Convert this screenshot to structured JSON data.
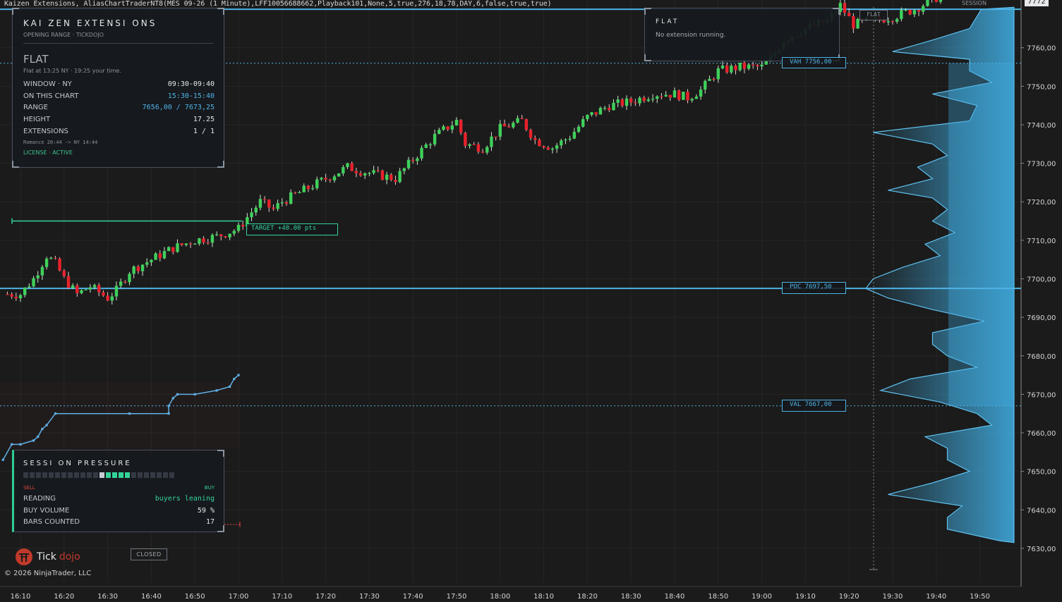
{
  "window": {
    "title": "Kaizen Extensions, AliasChartTraderNT8(MES 09-26 (1 Minute),LFF10056688662,Playback101,None,5,true,276,18,78,DAY,6,false,true,true)"
  },
  "kaizen_panel": {
    "title": "KAI ZEN  EXTENSI ONS",
    "subtitle": "OPENING RANGE · TICKDOJO",
    "state": "FLAT",
    "state_note": "Flat at 13:25 NY · 19:25 your time.",
    "rows": [
      {
        "label": "WINDOW · NY",
        "value": "09:30-09:40",
        "accent": false
      },
      {
        "label": "ON THIS CHART",
        "value": "15:30-15:40",
        "accent": true
      },
      {
        "label": "RANGE",
        "value": "7656,00 / 7673,25",
        "accent": true
      },
      {
        "label": "HEIGHT",
        "value": "17.25",
        "accent": false
      },
      {
        "label": "EXTENSIONS",
        "value": "1 / 1",
        "accent": false
      }
    ],
    "timezone_note": "Romance 20:44  ->  NY 14:44",
    "license": "LICENSE · ACTIVE"
  },
  "flat_panel": {
    "title": "FLAT",
    "message": "No extension running."
  },
  "session_pressure": {
    "title": "SESSI ON  PRESSURE",
    "sell_label": "SELL",
    "buy_label": "BUY",
    "meter_segments": 24,
    "meter_marker_index": 12,
    "meter_buy_filled": [
      13,
      14,
      15,
      16
    ],
    "rows": [
      {
        "label": "READING",
        "value": "buyers leaning",
        "color": "#34d399"
      },
      {
        "label": "BUY VOLUME",
        "value": "59 %",
        "color": "#e6e8eb"
      },
      {
        "label": "BARS COUNTED",
        "value": "17",
        "color": "#e6e8eb"
      }
    ]
  },
  "tags": {
    "target": "TARGET  +40.00 pts",
    "vah": "VAH  7756,00",
    "poc": "POC  7697,50",
    "val": "VAL  7667,00",
    "flat": "FLAT",
    "closed": "CLOSED",
    "session": "SESSION",
    "top_price": "7772"
  },
  "branding": {
    "logo_tick": "Tick",
    "logo_dojo": "dojo",
    "copyright": "© 2026 NinjaTrader, LLC"
  },
  "colors": {
    "up": "#3fd05a",
    "down": "#e8222c",
    "level_line": "#4fb3e6",
    "profile": "#3fa9dc",
    "green_accent": "#34d399",
    "background": "#1b1b1b"
  },
  "chart_data": {
    "type": "candlestick",
    "instrument": "MES 09-26 (1 Minute)",
    "y_tick_labels": [
      "7760,00",
      "7750,00",
      "7740,00",
      "7730,00",
      "7720,00",
      "7710,00",
      "7700,00",
      "7690,00",
      "7680,00",
      "7670,00",
      "7660,00",
      "7650,00",
      "7640,00",
      "7630,00"
    ],
    "y_ticks": [
      7760,
      7750,
      7740,
      7730,
      7720,
      7710,
      7700,
      7690,
      7680,
      7670,
      7660,
      7650,
      7640,
      7630
    ],
    "ylim": [
      7625.5,
      7774.5
    ],
    "x_tick_labels": [
      "16:10",
      "16:20",
      "16:30",
      "16:40",
      "16:50",
      "17:00",
      "17:10",
      "17:20",
      "17:30",
      "17:40",
      "17:50",
      "18:00",
      "18:10",
      "18:20",
      "18:30",
      "18:40",
      "18:50",
      "19:00",
      "19:10",
      "19:20",
      "19:30",
      "19:40",
      "19:50"
    ],
    "levels": {
      "vah": 7756.0,
      "poc": 7697.5,
      "val": 7667.0,
      "upper_line": 7770.0,
      "target": 7715.0
    },
    "grid": true,
    "close_series": [
      [
        "16:07",
        7696
      ],
      [
        "16:10",
        7696
      ],
      [
        "16:13",
        7700
      ],
      [
        "16:16",
        7706
      ],
      [
        "16:18",
        7704
      ],
      [
        "16:20",
        7700
      ],
      [
        "16:23",
        7696
      ],
      [
        "16:26",
        7698
      ],
      [
        "16:30",
        7695
      ],
      [
        "16:32",
        7697
      ],
      [
        "16:35",
        7702
      ],
      [
        "16:40",
        7705
      ],
      [
        "16:45",
        7708
      ],
      [
        "16:50",
        7710
      ],
      [
        "16:55",
        7711
      ],
      [
        "17:00",
        7713
      ],
      [
        "17:02",
        7716
      ],
      [
        "17:05",
        7720
      ],
      [
        "17:08",
        7718
      ],
      [
        "17:10",
        7720
      ],
      [
        "17:15",
        7723
      ],
      [
        "17:20",
        7726
      ],
      [
        "17:25",
        7729
      ],
      [
        "17:28",
        7728
      ],
      [
        "17:32",
        7727
      ],
      [
        "17:36",
        7726
      ],
      [
        "17:40",
        7731
      ],
      [
        "17:45",
        7737
      ],
      [
        "17:50",
        7741
      ],
      [
        "17:52",
        7735
      ],
      [
        "17:56",
        7734
      ],
      [
        "18:00",
        7739
      ],
      [
        "18:05",
        7741
      ],
      [
        "18:08",
        7736
      ],
      [
        "18:12",
        7734
      ],
      [
        "18:16",
        7737
      ],
      [
        "18:20",
        7742
      ],
      [
        "18:25",
        7745
      ],
      [
        "18:30",
        7746
      ],
      [
        "18:35",
        7748
      ],
      [
        "18:40",
        7748
      ],
      [
        "18:43",
        7747
      ],
      [
        "18:46",
        7749
      ],
      [
        "18:50",
        7754
      ],
      [
        "18:55",
        7755
      ],
      [
        "19:00",
        7755
      ],
      [
        "19:02",
        7757
      ],
      [
        "19:05",
        7762
      ],
      [
        "19:10",
        7765
      ],
      [
        "19:15",
        7767
      ],
      [
        "19:18",
        7771
      ],
      [
        "19:21",
        7766
      ],
      [
        "19:25",
        7767
      ],
      [
        "19:30",
        7768
      ],
      [
        "19:35",
        7770
      ],
      [
        "19:40",
        7773
      ],
      [
        "19:45",
        7776
      ],
      [
        "19:50",
        7776
      ]
    ],
    "volume_profile": {
      "right_edge_price_range": [
        7631.5,
        7770.5
      ],
      "points": [
        [
          7770,
          0.22
        ],
        [
          7765,
          0.3
        ],
        [
          7762,
          0.55
        ],
        [
          7759,
          0.82
        ],
        [
          7757,
          0.3
        ],
        [
          7754,
          0.3
        ],
        [
          7751,
          0.15
        ],
        [
          7748,
          0.55
        ],
        [
          7745,
          0.25
        ],
        [
          7741,
          0.3
        ],
        [
          7738,
          0.95
        ],
        [
          7735,
          0.55
        ],
        [
          7732,
          0.45
        ],
        [
          7729,
          0.65
        ],
        [
          7726,
          0.55
        ],
        [
          7723,
          0.85
        ],
        [
          7721,
          0.55
        ],
        [
          7718,
          0.45
        ],
        [
          7715,
          0.55
        ],
        [
          7712,
          0.4
        ],
        [
          7709,
          0.6
        ],
        [
          7706,
          0.5
        ],
        [
          7703,
          0.75
        ],
        [
          7700,
          0.95
        ],
        [
          7697.5,
          1.0
        ],
        [
          7695,
          0.85
        ],
        [
          7692,
          0.55
        ],
        [
          7689,
          0.2
        ],
        [
          7686,
          0.55
        ],
        [
          7683,
          0.55
        ],
        [
          7680,
          0.45
        ],
        [
          7677,
          0.25
        ],
        [
          7674,
          0.7
        ],
        [
          7671,
          0.9
        ],
        [
          7668,
          0.5
        ],
        [
          7665,
          0.25
        ],
        [
          7662,
          0.15
        ],
        [
          7659,
          0.6
        ],
        [
          7656,
          0.45
        ],
        [
          7653,
          0.45
        ],
        [
          7650,
          0.3
        ],
        [
          7647,
          0.55
        ],
        [
          7644,
          0.85
        ],
        [
          7641,
          0.35
        ],
        [
          7638,
          0.45
        ],
        [
          7635,
          0.45
        ],
        [
          7632,
          0.1
        ]
      ]
    },
    "pressure_line": [
      [
        "16:06",
        7653
      ],
      [
        "16:08",
        7657
      ],
      [
        "16:10",
        7657
      ],
      [
        "16:13",
        7658
      ],
      [
        "16:14",
        7659
      ],
      [
        "16:15",
        7661
      ],
      [
        "16:16",
        7662
      ],
      [
        "16:18",
        7665
      ],
      [
        "16:35",
        7665
      ],
      [
        "16:44",
        7665
      ],
      [
        "16:44",
        7667
      ],
      [
        "16:45",
        7669
      ],
      [
        "16:46",
        7670
      ],
      [
        "16:50",
        7670
      ],
      [
        "16:55",
        7671
      ],
      [
        "16:58",
        7672
      ],
      [
        "16:59",
        7674
      ],
      [
        "17:00",
        7675
      ]
    ]
  }
}
